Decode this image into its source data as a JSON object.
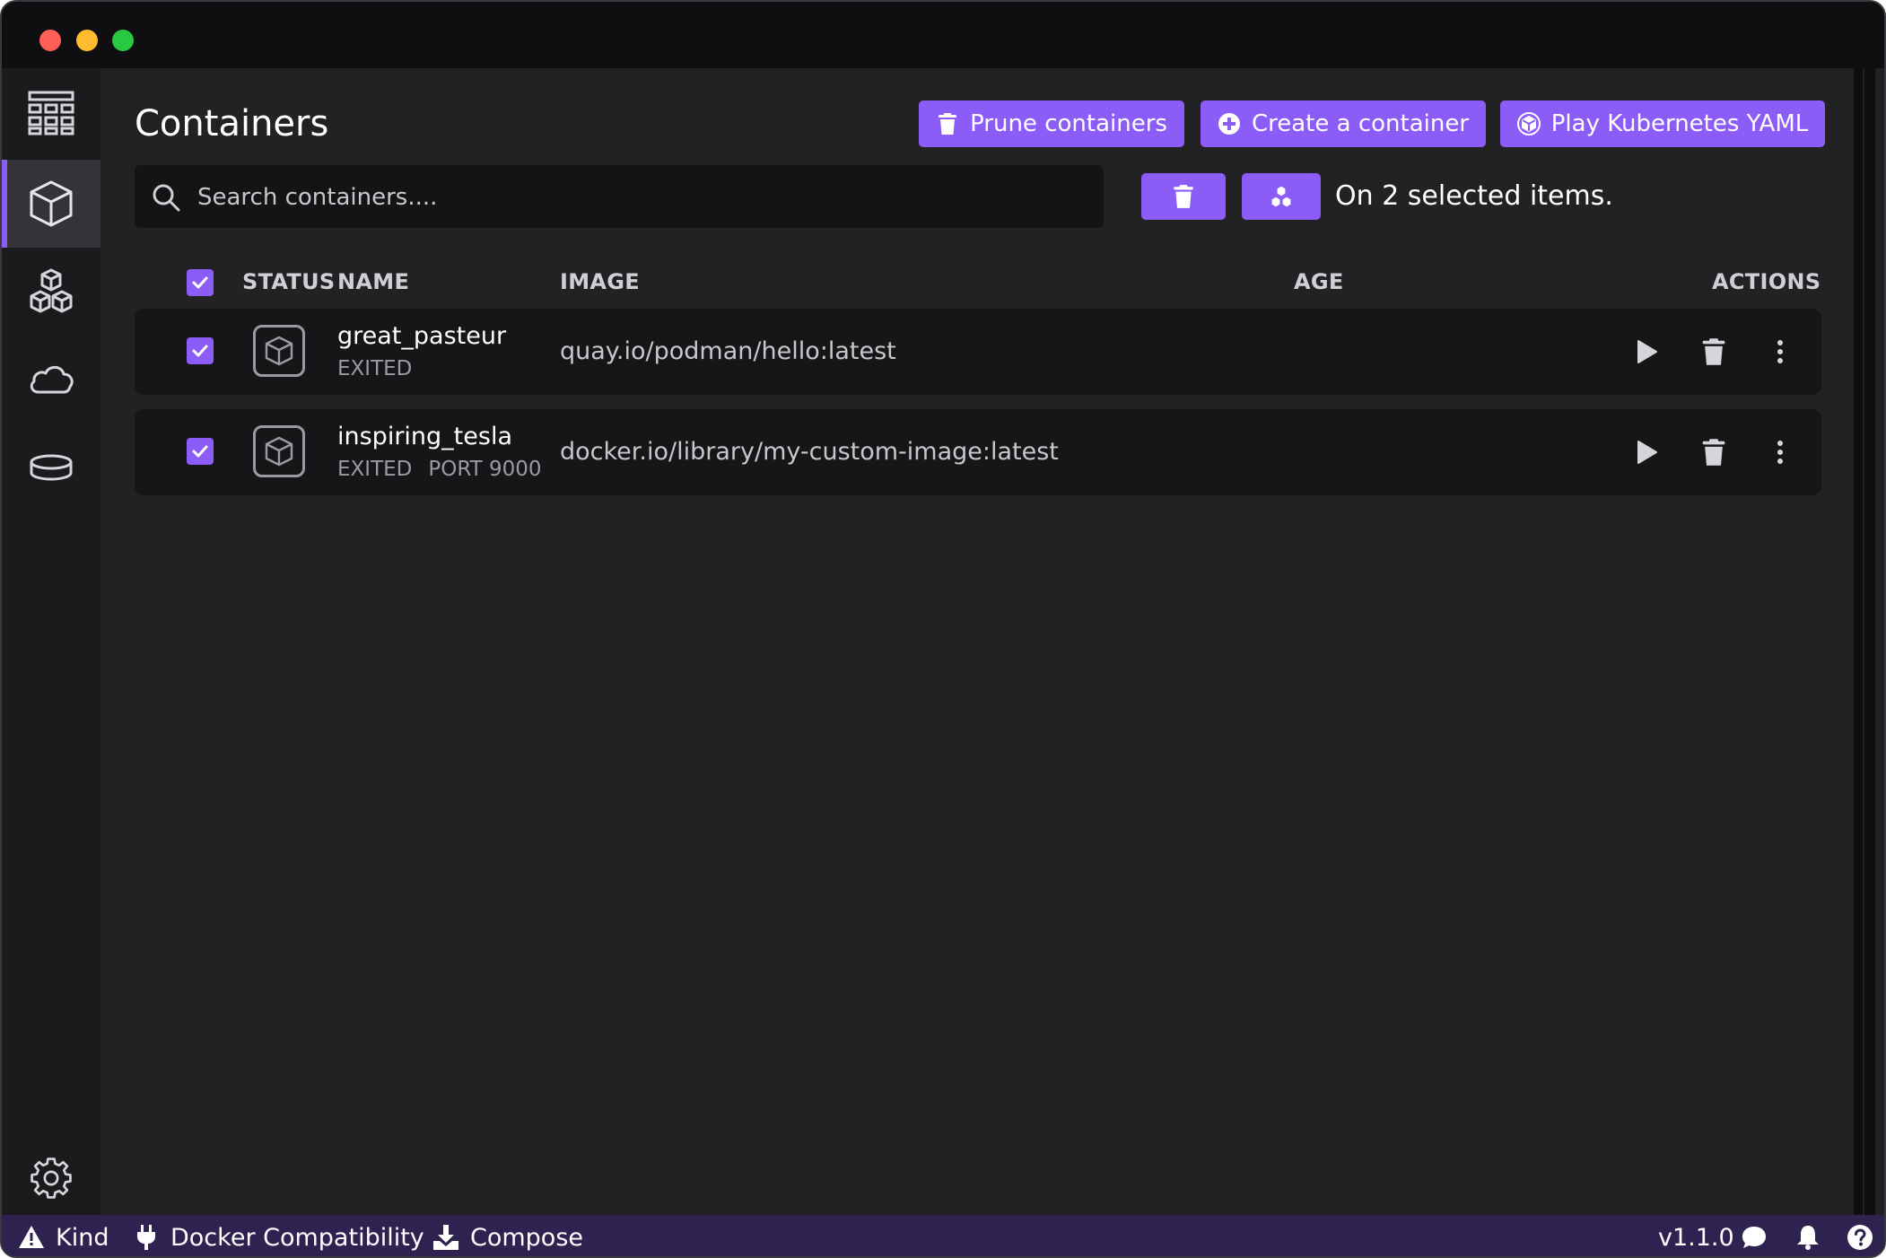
{
  "page": {
    "title": "Containers"
  },
  "header_buttons": {
    "prune": "Prune containers",
    "create": "Create a container",
    "play": "Play Kubernetes YAML"
  },
  "search": {
    "placeholder": "Search containers...."
  },
  "bulk": {
    "label": "On 2 selected items."
  },
  "table": {
    "columns": {
      "status": "STATUS",
      "name": "NAME",
      "image": "IMAGE",
      "age": "AGE",
      "actions": "ACTIONS"
    },
    "rows": [
      {
        "name": "great_pasteur",
        "state": "EXITED",
        "port": "",
        "image": "quay.io/podman/hello:latest",
        "age": "",
        "selected": true
      },
      {
        "name": "inspiring_tesla",
        "state": "EXITED",
        "port": "PORT 9000",
        "image": "docker.io/library/my-custom-image:latest",
        "age": "",
        "selected": true
      }
    ]
  },
  "sidebar": {
    "items": [
      {
        "id": "dashboard",
        "icon": "dashboard-icon"
      },
      {
        "id": "containers",
        "icon": "cube-icon",
        "active": true
      },
      {
        "id": "pods",
        "icon": "cubes-icon"
      },
      {
        "id": "images",
        "icon": "cloud-icon"
      },
      {
        "id": "volumes",
        "icon": "database-icon"
      }
    ],
    "settings_icon": "gear-icon"
  },
  "statusbar": {
    "kind": "Kind",
    "docker_compat": "Docker Compatibility",
    "compose": "Compose",
    "version": "v1.1.0"
  },
  "colors": {
    "accent": "#8b5cf6",
    "background": "#222224",
    "sidebar": "#1b1b1e",
    "statusbar": "#2e2250",
    "row": "#161618"
  }
}
